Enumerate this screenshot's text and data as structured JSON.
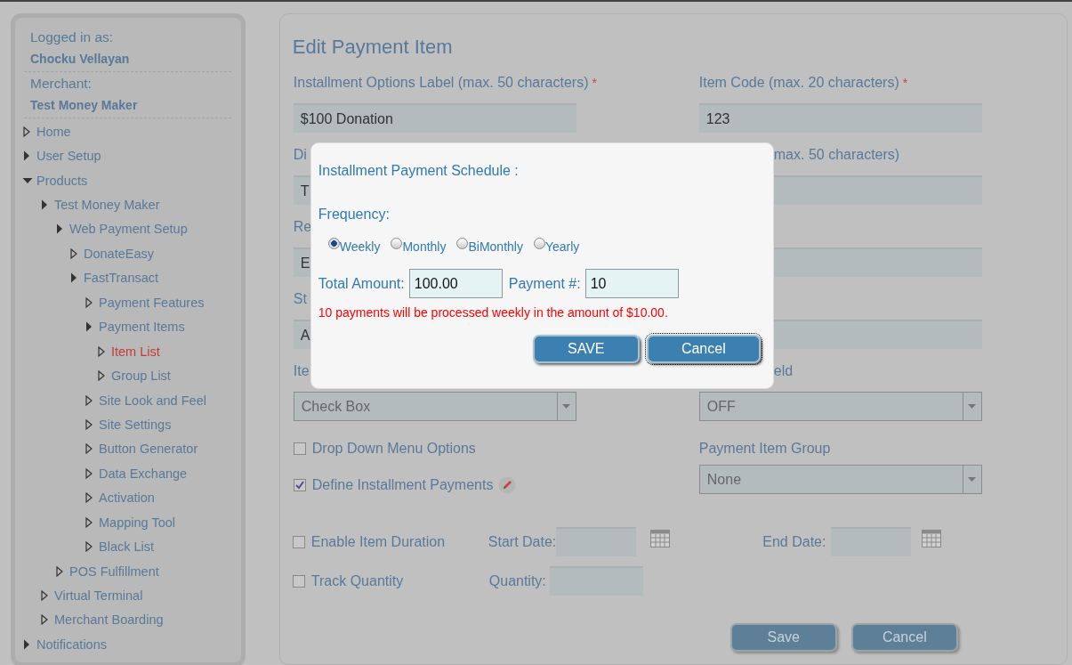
{
  "sidebar": {
    "logged_in_label": "Logged in as:",
    "user_name": "Chocku Vellayan",
    "merchant_label": "Merchant:",
    "merchant_name": "Test Money Maker",
    "items": [
      {
        "label": "Home",
        "kind": "leaf",
        "expanded": false,
        "selected": false
      },
      {
        "label": "User Setup",
        "kind": "branch",
        "expanded": false,
        "selected": false
      },
      {
        "label": "Products",
        "kind": "branch",
        "expanded": true,
        "selected": false,
        "children": [
          {
            "label": "Test Money Maker",
            "kind": "branch",
            "expanded": false,
            "selected": false,
            "children": [
              {
                "label": "Web Payment Setup",
                "kind": "branch",
                "expanded": false,
                "selected": false,
                "children": [
                  {
                    "label": "DonateEasy",
                    "kind": "leaf",
                    "expanded": false,
                    "selected": false
                  },
                  {
                    "label": "FastTransact",
                    "kind": "branch",
                    "expanded": false,
                    "selected": false,
                    "children": [
                      {
                        "label": "Payment Features",
                        "kind": "leaf",
                        "expanded": false,
                        "selected": false
                      },
                      {
                        "label": "Payment Items",
                        "kind": "branch",
                        "expanded": false,
                        "selected": false,
                        "children": [
                          {
                            "label": "Item List",
                            "kind": "leaf",
                            "expanded": false,
                            "selected": true
                          },
                          {
                            "label": "Group List",
                            "kind": "leaf",
                            "expanded": false,
                            "selected": false
                          }
                        ]
                      },
                      {
                        "label": "Site Look and Feel",
                        "kind": "leaf",
                        "expanded": false,
                        "selected": false
                      },
                      {
                        "label": "Site Settings",
                        "kind": "leaf",
                        "expanded": false,
                        "selected": false
                      },
                      {
                        "label": "Button Generator",
                        "kind": "leaf",
                        "expanded": false,
                        "selected": false
                      },
                      {
                        "label": "Data Exchange",
                        "kind": "leaf",
                        "expanded": false,
                        "selected": false
                      },
                      {
                        "label": "Activation",
                        "kind": "leaf",
                        "expanded": false,
                        "selected": false
                      },
                      {
                        "label": "Mapping Tool",
                        "kind": "leaf",
                        "expanded": false,
                        "selected": false
                      },
                      {
                        "label": "Black List",
                        "kind": "leaf",
                        "expanded": false,
                        "selected": false
                      }
                    ]
                  }
                ]
              },
              {
                "label": "POS Fulfillment",
                "kind": "leaf",
                "expanded": false,
                "selected": false
              }
            ]
          },
          {
            "label": "Virtual Terminal",
            "kind": "leaf",
            "expanded": false,
            "selected": false
          },
          {
            "label": "Merchant Boarding",
            "kind": "leaf",
            "expanded": false,
            "selected": false
          }
        ]
      },
      {
        "label": "Notifications",
        "kind": "branch",
        "expanded": false,
        "selected": false
      }
    ]
  },
  "form": {
    "title": "Edit Payment Item",
    "rows": [
      {
        "left": {
          "kind": "text",
          "label": "Installment Options Label (max. 50 characters)",
          "required_mark": "*",
          "value": "$100 Donation"
        },
        "right": {
          "kind": "text",
          "label": "Item Code (max. 20 characters)",
          "required_mark": "*",
          "value": "123"
        }
      },
      {
        "left": {
          "kind": "text",
          "label": "Di",
          "value": "T"
        },
        "right": {
          "kind": "text",
          "label": "max. 50 characters)"
        }
      },
      {
        "left": {
          "kind": "text",
          "label": "Re",
          "value": "E"
        },
        "right": {
          "kind": "text"
        }
      },
      {
        "left": {
          "kind": "text",
          "label": "St",
          "value": "A"
        },
        "right": {
          "kind": "text"
        }
      },
      {
        "left": {
          "kind": "select",
          "label": "Ite",
          "value": "Check Box"
        },
        "right": {
          "kind": "select",
          "label": "eld",
          "value": "OFF"
        }
      }
    ],
    "options": [
      {
        "label": "Drop Down Menu Options",
        "checked": false,
        "editable": false
      },
      {
        "label": "Define Installment Payments",
        "checked": true,
        "editable": true
      }
    ],
    "group": {
      "label": "Payment Item Group",
      "value": "None"
    },
    "duration": {
      "label": "Enable Item Duration",
      "checked": false,
      "start_label": "Start Date:",
      "end_label": "End Date:"
    },
    "quantity": {
      "label": "Track Quantity",
      "checked": false,
      "field_label": "Quantity:"
    },
    "buttons": [
      "Save",
      "Cancel"
    ]
  },
  "modal": {
    "title": "Installment Payment Schedule :",
    "frequency_label": "Frequency:",
    "frequencies": [
      {
        "label": "Weekly",
        "selected": true
      },
      {
        "label": "Monthly",
        "selected": false
      },
      {
        "label": "BiMonthly",
        "selected": false
      },
      {
        "label": "Yearly",
        "selected": false
      }
    ],
    "total_label": "Total Amount:",
    "total_value": "100.00",
    "count_label": "Payment #:",
    "count_value": "10",
    "message": "10 payments will be processed weekly in the amount of $10.00.",
    "buttons": [
      {
        "label": "SAVE",
        "focused": false
      },
      {
        "label": "Cancel",
        "focused": true
      }
    ]
  }
}
